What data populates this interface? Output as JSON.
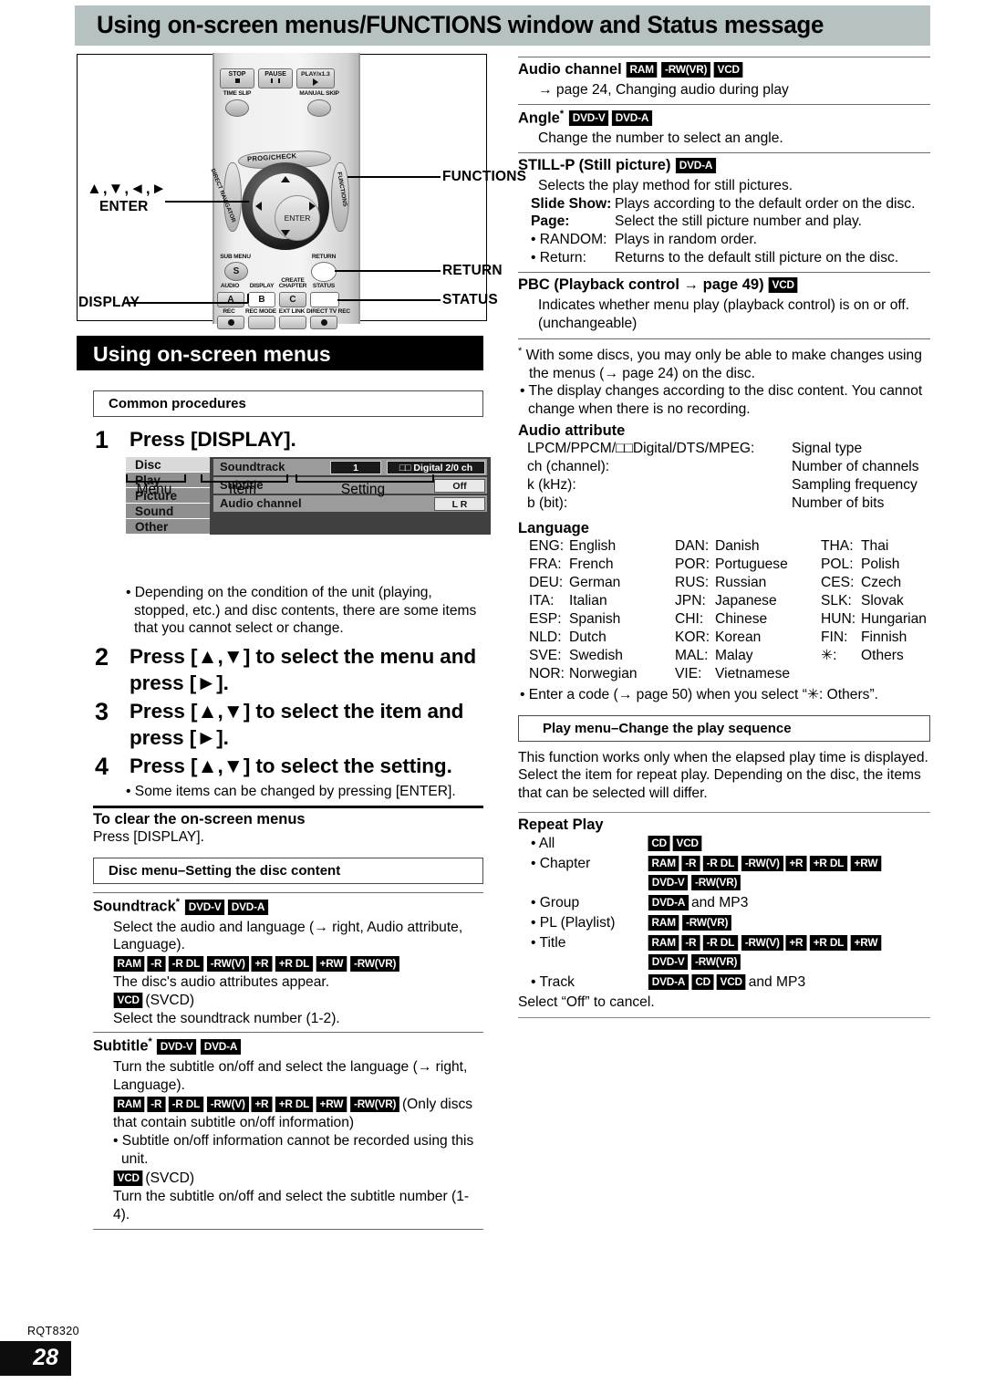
{
  "header": {
    "title": "Using on-screen menus/FUNCTIONS window and Status message"
  },
  "remote": {
    "buttons": {
      "stop": "STOP",
      "pause": "PAUSE",
      "play": "PLAY/x1.3",
      "time_slip": "TIME SLIP",
      "manual_skip": "MANUAL SKIP",
      "prog_check": "PROG/CHECK",
      "direct_navigator": "DIRECT NAVIGATOR",
      "functions_arc": "FUNCTIONS",
      "enter": "ENTER",
      "sub_menu": "SUB MENU",
      "sub_menu_key": "S",
      "return": "RETURN",
      "audio": "AUDIO",
      "audio_key": "A",
      "display": "DISPLAY",
      "display_key": "B",
      "create_chapter_1": "CREATE",
      "create_chapter_2": "CHAPTER",
      "create_chapter_key": "C",
      "status": "STATUS",
      "rec": "REC",
      "rec_mode": "REC MODE",
      "ext_link": "EXT LINK",
      "direct_tv_rec": "DIRECT TV REC"
    },
    "callouts": {
      "functions": "FUNCTIONS",
      "return": "RETURN",
      "status": "STATUS",
      "display": "DISPLAY",
      "arrows": "▲,▼,◄,►",
      "enter": "ENTER"
    }
  },
  "section_title": "Using on-screen menus",
  "common": {
    "heading": "Common procedures",
    "step1_num": "1",
    "step1_text": "Press [DISPLAY].",
    "osd": {
      "menu": [
        "Disc",
        "Play",
        "Picture",
        "Sound",
        "Other"
      ],
      "rows": [
        {
          "label": "Soundtrack",
          "value1": "1",
          "value2": "□□ Digital  2/0 ch"
        },
        {
          "label": "Subtitle",
          "value1": "Off"
        },
        {
          "label": "Audio channel",
          "value1": "L R"
        }
      ],
      "brackets": [
        "Menu",
        "Item",
        "Setting"
      ]
    },
    "note1": "Depending on the condition of the unit (playing, stopped, etc.) and disc contents, there are some items that you cannot select or change.",
    "step2_num": "2",
    "step2_text": "Press [▲,▼] to select the menu and press [►].",
    "step3_num": "3",
    "step3_text": "Press [▲,▼] to select the item and press [►].",
    "step4_num": "4",
    "step4_text": "Press [▲,▼] to select the setting.",
    "note2": "Some items can be changed by pressing [ENTER].",
    "clear_heading": "To clear the on-screen menus",
    "clear_text": "Press [DISPLAY]."
  },
  "disc_menu": {
    "heading": "Disc menu–Setting the disc content",
    "soundtrack": {
      "title": "Soundtrack",
      "asterisk": "*",
      "badges": [
        "DVD-V",
        "DVD-A"
      ],
      "body1": "Select the audio and language (→ right, Audio attribute, Language).",
      "badges2": [
        "RAM",
        "-R",
        "-R DL",
        "-RW(V)",
        "+R",
        "+R DL",
        "+RW",
        "-RW(VR)"
      ],
      "body2": "The disc's audio attributes appear.",
      "badges3": [
        "VCD"
      ],
      "badges3_note": "(SVCD)",
      "body3": "Select the soundtrack number (1-2)."
    },
    "subtitle": {
      "title": "Subtitle",
      "asterisk": "*",
      "badges": [
        "DVD-V",
        "DVD-A"
      ],
      "body1": "Turn the subtitle on/off and select the language (→ right, Language).",
      "badges2": [
        "RAM",
        "-R",
        "-R DL",
        "-RW(V)",
        "+R",
        "+R DL",
        "+RW",
        "-RW(VR)"
      ],
      "badges2_note": "(Only discs that contain subtitle on/off information)",
      "bullet1": "Subtitle on/off information cannot be recorded using this unit.",
      "badges3": [
        "VCD"
      ],
      "badges3_note": "(SVCD)",
      "body3": "Turn the subtitle on/off and select the subtitle number (1-4)."
    }
  },
  "right": {
    "audio_channel": {
      "title": "Audio channel",
      "badges": [
        "RAM",
        "-RW(VR)",
        "VCD"
      ],
      "body": "→ page 24, Changing audio during play"
    },
    "angle": {
      "title": "Angle",
      "asterisk": "*",
      "badges": [
        "DVD-V",
        "DVD-A"
      ],
      "body": "Change the number to select an angle."
    },
    "stillp": {
      "title": "STILL-P (Still picture)",
      "badges": [
        "DVD-A"
      ],
      "body": "Selects the play method for still pictures.",
      "rows": [
        {
          "label": "Slide Show:",
          "value": "Plays according to the default order on the disc.",
          "bold": true
        },
        {
          "label": "Page:",
          "value": "Select the still picture number and play.",
          "bold": true
        },
        {
          "label": "• RANDOM:",
          "value": "Plays in random order.",
          "bold": false
        },
        {
          "label": "• Return:",
          "value": "Returns to the default still picture on the disc.",
          "bold": false
        }
      ]
    },
    "pbc": {
      "title": "PBC (Playback control → page 49)",
      "badges": [
        "VCD"
      ],
      "body": "Indicates whether menu play (playback control) is on or off. (unchangeable)"
    },
    "footnote1": "With some discs, you may only be able to make changes using the menus (→ page 24) on the disc.",
    "footnote2": "The display changes according to the disc content. You cannot change when there is no recording.",
    "audio_attribute": {
      "title": "Audio attribute",
      "rows": [
        {
          "left": "LPCM/PPCM/□□Digital/DTS/MPEG:",
          "right": "Signal type"
        },
        {
          "left": "ch (channel):",
          "right": "Number of channels"
        },
        {
          "left": "k (kHz):",
          "right": "Sampling frequency"
        },
        {
          "left": "b (bit):",
          "right": "Number of bits"
        }
      ]
    },
    "language": {
      "title": "Language",
      "col1": [
        {
          "code": "ENG:",
          "name": "English"
        },
        {
          "code": "FRA:",
          "name": "French"
        },
        {
          "code": "DEU:",
          "name": "German"
        },
        {
          "code": "ITA:",
          "name": "Italian"
        },
        {
          "code": "ESP:",
          "name": "Spanish"
        },
        {
          "code": "NLD:",
          "name": "Dutch"
        },
        {
          "code": "SVE:",
          "name": "Swedish"
        },
        {
          "code": "NOR:",
          "name": "Norwegian"
        }
      ],
      "col2": [
        {
          "code": "DAN:",
          "name": "Danish"
        },
        {
          "code": "POR:",
          "name": "Portuguese"
        },
        {
          "code": "RUS:",
          "name": "Russian"
        },
        {
          "code": "JPN:",
          "name": "Japanese"
        },
        {
          "code": "CHI:",
          "name": "Chinese"
        },
        {
          "code": "KOR:",
          "name": "Korean"
        },
        {
          "code": "MAL:",
          "name": "Malay"
        },
        {
          "code": "VIE:",
          "name": "Vietnamese"
        }
      ],
      "col3": [
        {
          "code": "THA:",
          "name": "Thai"
        },
        {
          "code": "POL:",
          "name": "Polish"
        },
        {
          "code": "CES:",
          "name": "Czech"
        },
        {
          "code": "SLK:",
          "name": "Slovak"
        },
        {
          "code": "HUN:",
          "name": "Hungarian"
        },
        {
          "code": "FIN:",
          "name": "Finnish"
        },
        {
          "code": "✳:",
          "name": "Others"
        }
      ],
      "note": "Enter a code (→ page 50) when you select “✳: Others”."
    },
    "play_menu": {
      "heading": "Play menu–Change the play sequence",
      "body1": "This function works only when the elapsed play time is displayed.",
      "body2": "Select the item for repeat play. Depending on the disc, the items that can be selected will differ.",
      "repeat_title": "Repeat Play",
      "items": [
        {
          "label": "• All",
          "badges": [
            "CD",
            "VCD"
          ],
          "badges2": [],
          "suffix": ""
        },
        {
          "label": "• Chapter",
          "badges": [
            "RAM",
            "-R",
            "-R DL",
            "-RW(V)",
            "+R",
            "+R DL",
            "+RW"
          ],
          "badges2": [
            "DVD-V",
            "-RW(VR)"
          ],
          "suffix": ""
        },
        {
          "label": "• Group",
          "badges": [
            "DVD-A"
          ],
          "badges2": [],
          "suffix": "and MP3"
        },
        {
          "label": "• PL (Playlist)",
          "badges": [
            "RAM",
            "-RW(VR)"
          ],
          "badges2": [],
          "suffix": ""
        },
        {
          "label": "• Title",
          "badges": [
            "RAM",
            "-R",
            "-R DL",
            "-RW(V)",
            "+R",
            "+R DL",
            "+RW"
          ],
          "badges2": [
            "DVD-V",
            "-RW(VR)"
          ],
          "suffix": ""
        },
        {
          "label": "• Track",
          "badges": [
            "DVD-A",
            "CD",
            "VCD"
          ],
          "badges2": [],
          "suffix": "and MP3"
        }
      ],
      "cancel": "Select “Off” to cancel."
    }
  },
  "footer": {
    "rqt": "RQT8320",
    "page": "28"
  }
}
